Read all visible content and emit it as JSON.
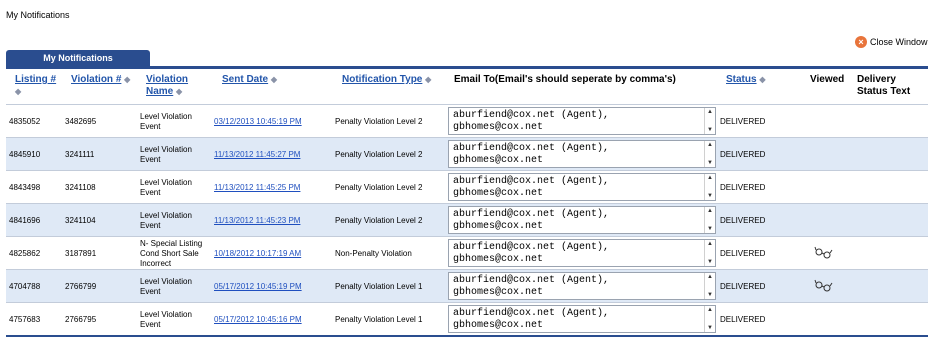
{
  "page_title": "My Notifications",
  "close_window": "Close Window",
  "tab_label": "My Notifications",
  "headers": {
    "listing": "Listing #",
    "violation_no": "Violation #",
    "violation_name": "Violation Name",
    "sent_date": "Sent Date",
    "notification_type": "Notification Type",
    "email_to": "Email To(Email's should seperate by comma's)",
    "status": "Status",
    "viewed": "Viewed",
    "delivery_status": "Delivery Status Text"
  },
  "rows": [
    {
      "listing": "4835052",
      "violation_no": "3482695",
      "violation_name": "Level Violation Event",
      "sent_date": "03/12/2013 10:45:19 PM",
      "notification_type": "Penalty Violation Level 2",
      "email": "aburfiend@cox.net (Agent),\ngbhomes@cox.net",
      "status": "DELIVERED",
      "viewed": false
    },
    {
      "listing": "4845910",
      "violation_no": "3241111",
      "violation_name": "Level Violation Event",
      "sent_date": "11/13/2012 11:45:27 PM",
      "notification_type": "Penalty Violation Level 2",
      "email": "aburfiend@cox.net (Agent),\ngbhomes@cox.net",
      "status": "DELIVERED",
      "viewed": false
    },
    {
      "listing": "4843498",
      "violation_no": "3241108",
      "violation_name": "Level Violation Event",
      "sent_date": "11/13/2012 11:45:25 PM",
      "notification_type": "Penalty Violation Level 2",
      "email": "aburfiend@cox.net (Agent),\ngbhomes@cox.net",
      "status": "DELIVERED",
      "viewed": false
    },
    {
      "listing": "4841696",
      "violation_no": "3241104",
      "violation_name": "Level Violation Event",
      "sent_date": "11/13/2012 11:45:23 PM",
      "notification_type": "Penalty Violation Level 2",
      "email": "aburfiend@cox.net (Agent),\ngbhomes@cox.net",
      "status": "DELIVERED",
      "viewed": false
    },
    {
      "listing": "4825862",
      "violation_no": "3187891",
      "violation_name": "N- Special Listing Cond Short Sale Incorrect",
      "sent_date": "10/18/2012 10:17:19 AM",
      "notification_type": "Non-Penalty Violation",
      "email": "aburfiend@cox.net (Agent),\ngbhomes@cox.net",
      "status": "DELIVERED",
      "viewed": true
    },
    {
      "listing": "4704788",
      "violation_no": "2766799",
      "violation_name": "Level Violation Event",
      "sent_date": "05/17/2012 10:45:19 PM",
      "notification_type": "Penalty Violation Level 1",
      "email": "aburfiend@cox.net (Agent),\ngbhomes@cox.net",
      "status": "DELIVERED",
      "viewed": true
    },
    {
      "listing": "4757683",
      "violation_no": "2766795",
      "violation_name": "Level Violation Event",
      "sent_date": "05/17/2012 10:45:16 PM",
      "notification_type": "Penalty Violation Level 1",
      "email": "aburfiend@cox.net (Agent),\ngbhomes@cox.net",
      "status": "DELIVERED",
      "viewed": false
    }
  ],
  "icons": {
    "close": "close-circle-icon",
    "sort": "sort-arrows-icon",
    "viewed": "glasses-icon"
  },
  "colors": {
    "accent": "#2a4d8f",
    "row_alt": "#dfe9f6",
    "link": "#1f4fbf"
  }
}
